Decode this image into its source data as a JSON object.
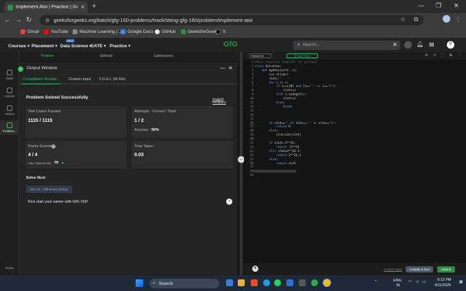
{
  "browser": {
    "tab_title": "Implement Atoi | Practice | Gee",
    "url": "geeksforgeeks.org/batch/gfg-160-problems/track/string-gfg-160/problem/implement-atoi",
    "bookmarks": [
      "Gmail",
      "YouTube",
      "Machine Learning | ...",
      "Google Docs",
      "GitHub",
      "GeeksforGeeks",
      "X"
    ]
  },
  "site_header": {
    "menus": [
      "Courses",
      "Placement",
      "Data Science",
      "GATE",
      "Practice"
    ],
    "new_badge": "NEW",
    "logo": "GfG",
    "search_placeholder": "Search..."
  },
  "rail": {
    "items": [
      "Dash",
      "Articles",
      "Videos",
      "Problem..."
    ],
    "prime": "Prime"
  },
  "problem_tabs": [
    "Problem",
    "Editorial",
    "Submissions"
  ],
  "output": {
    "title": "Output Window",
    "tabs": [
      "Compilation Results",
      "Custom Input",
      "Y.O.G.I. (AI Bot)"
    ],
    "status": "Problem Solved Successfully",
    "suggest": "Suggest Feedback",
    "test_cases_label": "Test Cases Passed",
    "test_cases_value": "1115 / 1115",
    "attempts_label": "Attempts : Correct / Total",
    "attempts_value": "1 / 2",
    "accuracy_label": "Accuracy :",
    "accuracy_value": "50%",
    "points_label": "Points Scored",
    "points_value": "4 / 4",
    "total_score_label": "Your Total Score:",
    "total_score_value": "79",
    "time_label": "Time Taken",
    "time_value": "0.03",
    "solve_next": "Solve Next",
    "next_problem": "Day 13 - Add Binary Strings",
    "kickstart": "Kick start your career with GfG 160!"
  },
  "editor": {
    "language": "Python3",
    "timer": "Start Timer",
    "code_lines": [
      "#User function Template for python3",
      "class Solution:",
      "    def myAtoi(self, s):",
      "        s=s.strip()",
      "        slnt=''",
      "        for i in s:",
      "            if i==s[0] and (i=='-' or i=='+'):",
      "                slnt+=i",
      "            elif i.isdigit():",
      "                slnt+=i",
      "            else:",
      "                break",
      "",
      "",
      "",
      "        if slnt=='' or slnt=='-' or slnt=='+':",
      "            return 0",
      "        else:",
      "            slnt=int(slnt)",
      "",
      "        if slnt<-2**31:",
      "            return -2**31",
      "        elif slnt>2**31-1:",
      "            return 2**31-1",
      "        else:",
      "            return slnt",
      "",
      "",
      ""
    ],
    "custom_input": "Custom Input",
    "compile_btn": "Compile & Run",
    "submit_btn": "Submit"
  },
  "taskbar": {
    "search": "Search",
    "lang1": "ENG",
    "lang2": "IN",
    "time": "9:12 PM",
    "date": "4/11/2025"
  }
}
